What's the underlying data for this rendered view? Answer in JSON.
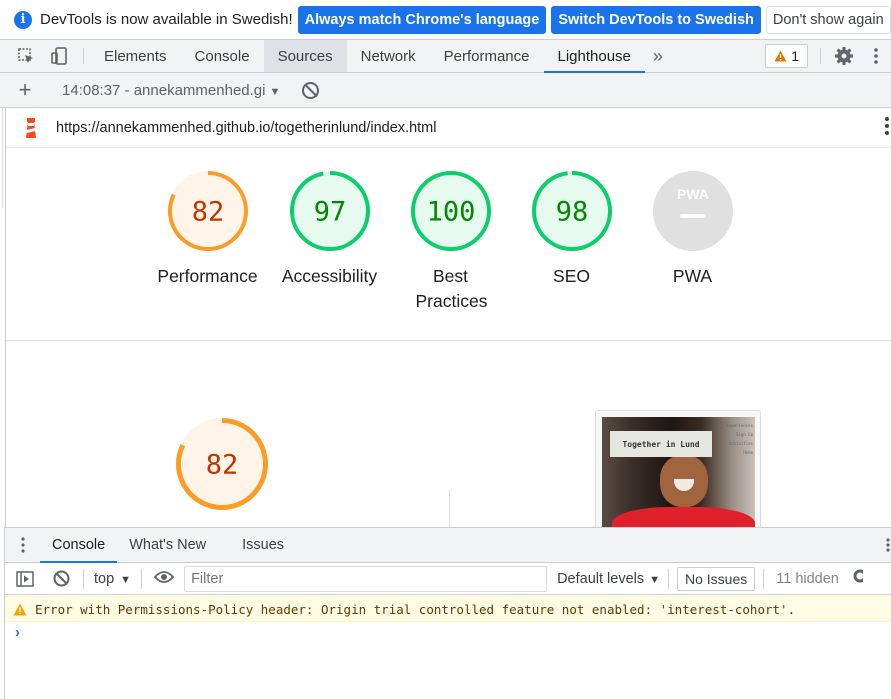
{
  "infobar": {
    "message": "DevTools is now available in Swedish!",
    "match_button": "Always match Chrome's language",
    "switch_button": "Switch DevTools to Swedish",
    "dismiss_button": "Don't show again"
  },
  "tabs": {
    "items": [
      "Elements",
      "Console",
      "Sources",
      "Network",
      "Performance",
      "Lighthouse"
    ],
    "hovered": "Sources",
    "active": "Lighthouse",
    "more": "»",
    "warning_count": "1"
  },
  "lighthouse": {
    "report_selector": "14:08:37 - annekammenhed.gi",
    "url": "https://annekammenhed.github.io/togetherinlund/index.html",
    "scores": [
      {
        "label": "Performance",
        "score": 82,
        "color": "#fa9d28",
        "fill": "#fff4e8",
        "text_color": "#c33300"
      },
      {
        "label": "Accessibility",
        "score": 97,
        "color": "#0cce6b",
        "fill": "#e6faf0",
        "text_color": "#008800"
      },
      {
        "label": "Best Practices",
        "score": 100,
        "color": "#0cce6b",
        "fill": "#e6faf0",
        "text_color": "#008800"
      },
      {
        "label": "SEO",
        "score": 98,
        "color": "#0cce6b",
        "fill": "#e6faf0",
        "text_color": "#008800"
      },
      {
        "label": "PWA",
        "score": null,
        "color": "#e0e0e0",
        "fill": "#e0e0e0",
        "text_color": "#ffffff"
      }
    ],
    "pwa_badge": "PWA",
    "detail_score": 82,
    "thumbnail": {
      "title": "Together in Lund",
      "nav": [
        "Experiences",
        "Sign Up",
        "Activities",
        "Home"
      ]
    }
  },
  "drawer": {
    "tabs": [
      "Console",
      "What's New",
      "Issues"
    ],
    "active": "Console"
  },
  "console": {
    "context": "top",
    "filter_placeholder": "Filter",
    "levels": "Default levels",
    "issues_button": "No Issues",
    "hidden": "11 hidden",
    "message": "Error with Permissions-Policy header: Origin trial controlled feature not enabled: 'interest-cohort'.",
    "prompt": "›"
  },
  "colors": {
    "accent": "#1a73e8",
    "warning": "#e37400"
  }
}
